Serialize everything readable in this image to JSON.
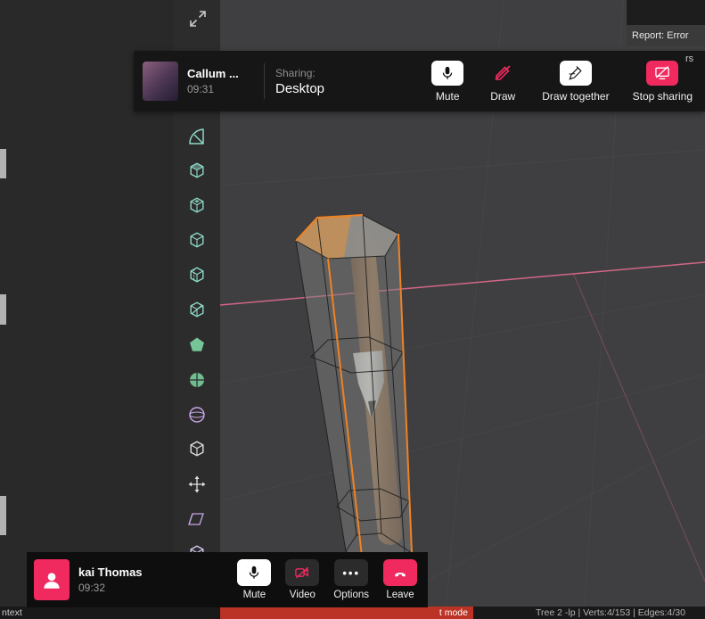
{
  "share_bar": {
    "presenter_name": "Callum ...",
    "presenter_time": "09:31",
    "sharing_label": "Sharing:",
    "sharing_value": "Desktop",
    "buttons": {
      "mute": "Mute",
      "draw": "Draw",
      "draw_together": "Draw together",
      "stop_sharing": "Stop sharing"
    }
  },
  "report_box": {
    "text": "Report: Error"
  },
  "fragment_rs": "rs",
  "toolbar": {
    "tools": [
      {
        "name": "measure-tool",
        "icon": "measure",
        "color": "#8fd8c8"
      },
      {
        "name": "extrude-tool",
        "icon": "cube-top",
        "color": "#8fd8c8"
      },
      {
        "name": "inset-faces-tool",
        "icon": "cube-inset",
        "color": "#8fd8c8"
      },
      {
        "name": "bevel-tool",
        "icon": "cube",
        "color": "#8fd8c8"
      },
      {
        "name": "loop-cut-tool",
        "icon": "cube-loop",
        "color": "#8fd8c8"
      },
      {
        "name": "knife-tool",
        "icon": "cube-knife",
        "color": "#8fd8c8"
      },
      {
        "name": "poly-build-tool",
        "icon": "pentagon",
        "color": "#7ed6a2"
      },
      {
        "name": "spin-tool",
        "icon": "quarters",
        "color": "#7ed6a2"
      },
      {
        "name": "smooth-tool",
        "icon": "sphere",
        "color": "#c9a6e8"
      },
      {
        "name": "edge-slide-tool",
        "icon": "cube",
        "color": "#e0e0e0"
      },
      {
        "name": "shrink-fatten-tool",
        "icon": "move",
        "color": "#e0e0e0"
      },
      {
        "name": "shear-tool",
        "icon": "shear",
        "color": "#c9a6e8"
      },
      {
        "name": "rip-region-tool",
        "icon": "cube",
        "color": "#d8c8ee"
      }
    ]
  },
  "call_bar": {
    "participant_name": "kai Thomas",
    "participant_time": "09:32",
    "buttons": {
      "mute": "Mute",
      "video": "Video",
      "options": "Options",
      "leave": "Leave"
    }
  },
  "status_bar": {
    "left_fragment": "ntext",
    "error_text": "t mode",
    "right_text": "Tree 2 -lp | Verts:4/153 | Edges:4/30"
  },
  "colors": {
    "accent_pink": "#f0295f",
    "error_red": "#bb3325",
    "axis_pink": "#d9698a",
    "selected_orange": "#f08224",
    "tool_teal": "#8fd8c8",
    "tool_green": "#7ed6a2",
    "tool_purple": "#c9a6e8"
  }
}
